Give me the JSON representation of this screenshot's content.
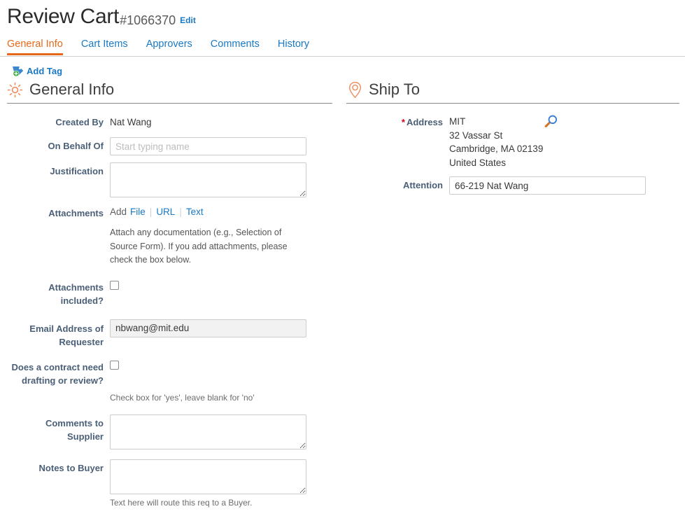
{
  "header": {
    "title": "Review Cart",
    "cart_number": "#1066370",
    "edit_label": "Edit"
  },
  "tabs": [
    {
      "label": "General Info",
      "active": true
    },
    {
      "label": "Cart Items",
      "active": false
    },
    {
      "label": "Approvers",
      "active": false
    },
    {
      "label": "Comments",
      "active": false
    },
    {
      "label": "History",
      "active": false
    }
  ],
  "add_tag": {
    "label": "Add Tag",
    "icon": "tag-plus-icon"
  },
  "general_info": {
    "section_title": "General Info",
    "section_icon": "gear-icon",
    "created_by": {
      "label": "Created By",
      "value": "Nat Wang"
    },
    "on_behalf_of": {
      "label": "On Behalf Of",
      "value": "",
      "placeholder": "Start typing name"
    },
    "justification": {
      "label": "Justification",
      "value": ""
    },
    "attachments": {
      "label": "Attachments",
      "add_word": "Add",
      "links": [
        "File",
        "URL",
        "Text"
      ],
      "separator": "|",
      "help": "Attach any documentation (e.g., Selection of Source Form). If you add attachments, please check the box below."
    },
    "attachments_included": {
      "label": "Attachments included?",
      "checked": false
    },
    "email_address": {
      "label": "Email Address of Requester",
      "value": "nbwang@mit.edu"
    },
    "contract_needed": {
      "label": "Does a contract need drafting or review?",
      "checked": false,
      "help": "Check box for 'yes', leave blank for 'no'"
    },
    "comments_to_supplier": {
      "label": "Comments to Supplier",
      "value": ""
    },
    "notes_to_buyer": {
      "label": "Notes to Buyer",
      "value": "",
      "help": "Text here will route this req to a Buyer."
    }
  },
  "ship_to": {
    "section_title": "Ship To",
    "section_icon": "map-pin-icon",
    "address": {
      "label": "Address",
      "required_marker": "*",
      "lines": [
        "MIT",
        "32 Vassar St",
        "Cambridge, MA 02139",
        "United States"
      ],
      "search_icon": "magnifier-icon"
    },
    "attention": {
      "label": "Attention",
      "value": "66-219 Nat Wang"
    }
  },
  "colors": {
    "accent_orange": "#e8681a",
    "link_blue": "#1979c3",
    "label_slate": "#4b5f77",
    "required_red": "#d0021b",
    "gear_orange": "#ef8b5b",
    "tag_blue": "#3a87d0",
    "plus_green": "#3aa93a"
  }
}
